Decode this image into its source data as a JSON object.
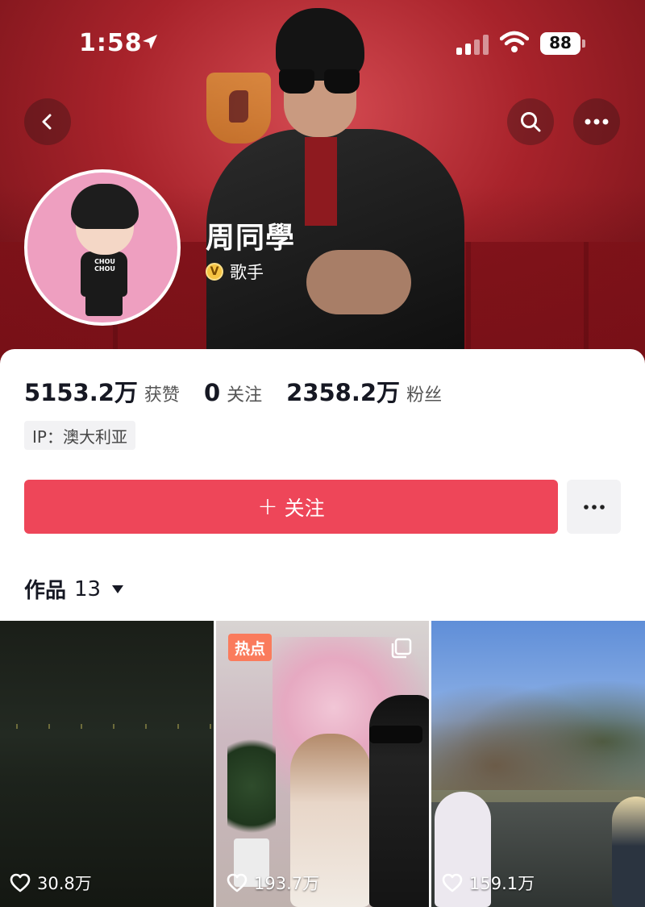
{
  "status_bar": {
    "time": "1:58",
    "battery": "88"
  },
  "header": {
    "back_icon": "chevron-left-icon",
    "search_icon": "search-icon",
    "more_icon": "ellipsis-icon"
  },
  "profile": {
    "name": "周同學",
    "verified_icon": "verified-v-icon",
    "verified_text": "歌手",
    "avatar_shirt_text": "CHOU CHOU"
  },
  "stats": [
    {
      "value": "5153.2万",
      "label": "获赞"
    },
    {
      "value": "0",
      "label": "关注"
    },
    {
      "value": "2358.2万",
      "label": "粉丝"
    }
  ],
  "ip_tag": "IP：澳大利亚",
  "follow_button": {
    "plus": "+",
    "label": "关注",
    "color": "#ee4659"
  },
  "works_tab": {
    "label": "作品",
    "count": "13"
  },
  "videos": [
    {
      "likes": "30.8万",
      "badge": ""
    },
    {
      "likes": "193.7万",
      "badge": "热点"
    },
    {
      "likes": "159.1万",
      "badge": ""
    }
  ]
}
